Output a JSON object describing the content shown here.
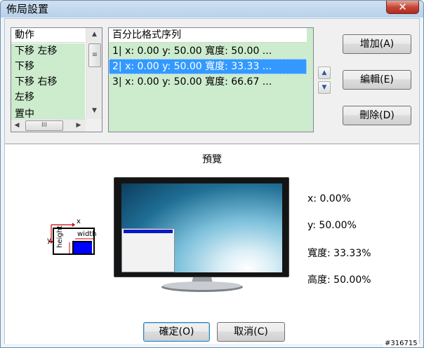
{
  "window": {
    "title": "佈局設置",
    "close_glyph": "✕"
  },
  "action_list": {
    "header": "動作",
    "items": [
      "下移 左移",
      "下移",
      "下移 右移",
      "左移",
      "置中"
    ]
  },
  "percent_list": {
    "header": "百分比格式序列",
    "items": [
      {
        "text": "1|  x:  0.00   y: 50.00   寬度:  50.00  ...",
        "selected": false
      },
      {
        "text": "2|  x:  0.00   y: 50.00   寬度:  33.33  ...",
        "selected": true
      },
      {
        "text": "3|  x:  0.00   y: 50.00   寬度:  66.67  ...",
        "selected": false
      }
    ]
  },
  "buttons": {
    "add": "增加(A)",
    "edit": "編輯(E)",
    "delete": "刪除(D)",
    "ok": "確定(O)",
    "cancel": "取消(C)"
  },
  "preview": {
    "title": "預覽",
    "x": "x: 0.00%",
    "y": "y: 50.00%",
    "width": "寬度: 33.33%",
    "height": "高度: 50.00%"
  },
  "diagram": {
    "x_label": "x",
    "y_label": "y",
    "width_label": "width",
    "height_label": "height"
  },
  "watermark": "#316715",
  "colors": {
    "selection": "#3399ff",
    "list_bg": "#cdebcd",
    "preview_window_bar": "#0818c8",
    "close_button": "#c6483a"
  }
}
